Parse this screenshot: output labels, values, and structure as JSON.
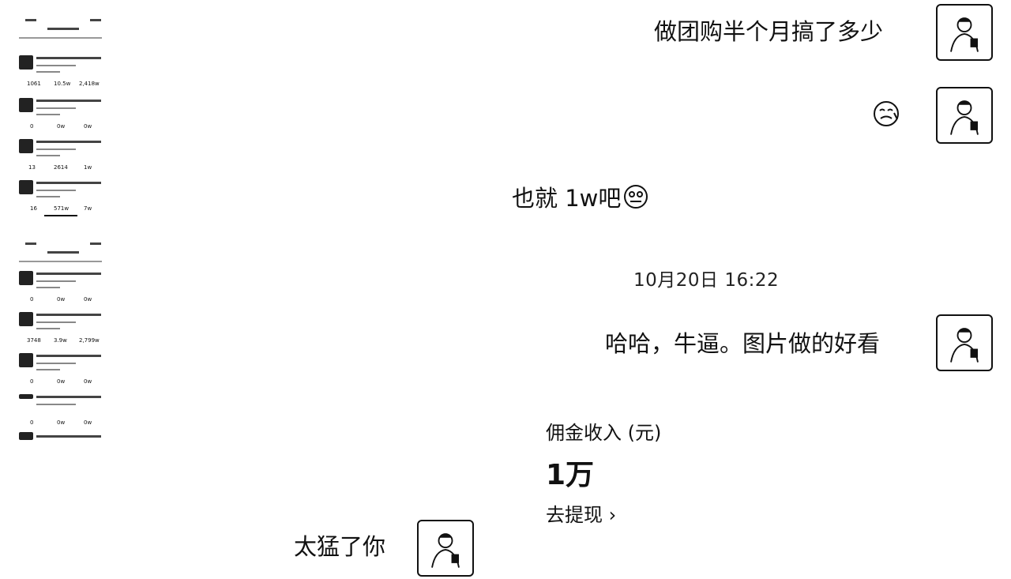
{
  "messages": {
    "m1": "做团购半个月搞了多少",
    "m2_emoji": "emoji-sticker",
    "m3": "也就 1w吧",
    "timestamp": "10月20日 16:22",
    "m4": "哈哈，牛逼。图片做的好看",
    "m5": "太猛了你"
  },
  "earnings_card": {
    "title": "佣金收入 (元)",
    "amount": "1万",
    "link": "去提现 ›"
  },
  "thumbnails": {
    "top_stats": [
      [
        "1061",
        "10.5w",
        "2,418w"
      ],
      [
        "0",
        "0w",
        "0w"
      ],
      [
        "13",
        "2614",
        "1w"
      ],
      [
        "16",
        "571w",
        "7w"
      ]
    ],
    "bottom_stats": [
      [
        "0",
        "0w",
        "0w"
      ],
      [
        "3748",
        "3.9w",
        "2,799w"
      ],
      [
        "0",
        "0w",
        "0w"
      ],
      [
        "0",
        "0w",
        "0w"
      ]
    ]
  },
  "icons": {
    "avatar": "avatar-person-icon",
    "emoji": "crying-face-icon",
    "chevron": "chevron-right-icon"
  }
}
